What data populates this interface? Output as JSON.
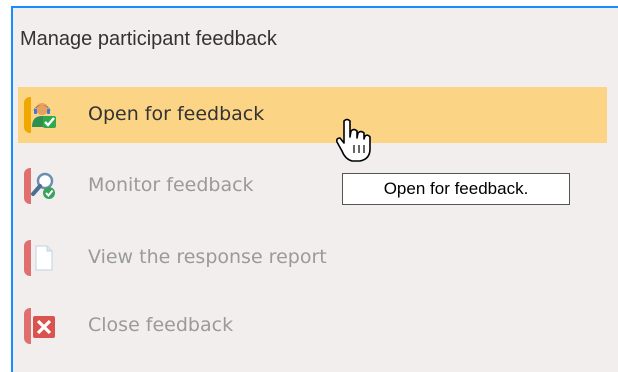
{
  "panel": {
    "title": "Manage participant feedback",
    "items": [
      {
        "label": "Open for feedback",
        "icon": "user-check-icon",
        "highlighted": true
      },
      {
        "label": "Monitor feedback",
        "icon": "magnifier-check-icon",
        "highlighted": false
      },
      {
        "label": "View the response report",
        "icon": "document-icon",
        "highlighted": false
      },
      {
        "label": "Close feedback",
        "icon": "close-x-icon",
        "highlighted": false
      }
    ]
  },
  "tooltip": {
    "text": "Open for feedback."
  },
  "colors": {
    "highlight": "#fcd486",
    "border_accent": "#1a8cff",
    "panel_bg": "#f2eeee",
    "bracket_open": "#f0a800",
    "bracket_other": "#e07070"
  }
}
